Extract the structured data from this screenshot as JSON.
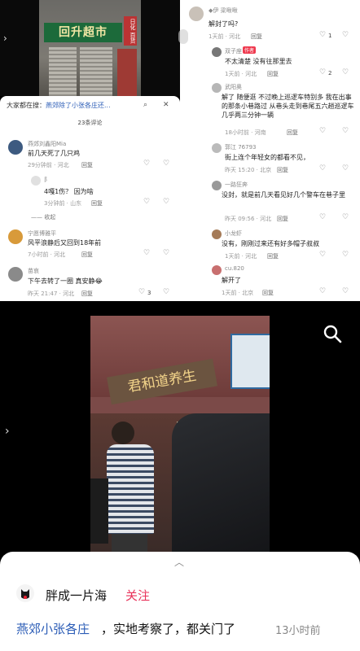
{
  "top_left_video": {
    "shop_sign": "回升超市",
    "sign_side": "日化 百货"
  },
  "left_panel": {
    "search_prefix": "大家都在搜：",
    "search_term": "燕郊除了小张各庄还...",
    "comment_count": "23条评论",
    "comments": [
      {
        "name": "燕郊刘鑫阳Mia",
        "text": "前几天死了几只鸡",
        "meta": "29分钟前 · 河北",
        "reply": "回复",
        "likes": ""
      },
      {
        "name": "阝",
        "text": "4嘎1伤？ 因为啥",
        "meta": "3分钟前 · 山东",
        "reply": "回复",
        "likes": ""
      },
      {
        "name": "",
        "text": "",
        "meta": "—— 收起",
        "reply": "",
        "likes": ""
      },
      {
        "name": "宁愿博雅平",
        "text": "风平浪静后又回到18年前",
        "meta": "7小时前 · 河北",
        "reply": "回复",
        "likes": ""
      },
      {
        "name": "苗哀",
        "text": "下午去转了一圈  真安静😂",
        "meta": "昨天 21:47 · 河北",
        "reply": "回复",
        "likes": "3"
      }
    ]
  },
  "right_panel": {
    "comments": [
      {
        "name": "◆伊 梁啾啾",
        "text": "解封了吗?",
        "meta": "1天前 · 河北",
        "reply": "回复",
        "likes": "1"
      },
      {
        "name": "双子座",
        "text": "不太清楚 没有往那里去",
        "meta": "1天前 · 河北",
        "reply": "回复",
        "likes": "2",
        "badge": "作者"
      },
      {
        "name": "武阳奥",
        "text": "解了  随便逛  不过晚上巡逻车特别多  我在出事的那条小巷路过  从巷头走到巷尾五六趟巡逻车  几乎两三分钟一辆",
        "meta": "18小时前 · 河南",
        "reply": "回复",
        "likes": ""
      },
      {
        "name": "郭江 76793",
        "text": "街上连个年轻女的都看不见，",
        "meta": "昨天 15:20 · 北京",
        "reply": "回复",
        "likes": ""
      },
      {
        "name": "一路狂奔",
        "text": "没封，就是前几天看见好几个警车在巷子里",
        "meta": "昨天 09:56 · 河北",
        "reply": "回复",
        "likes": ""
      },
      {
        "name": "小龙虾",
        "text": "没有，刚刚过来还有好多帽子叔叔",
        "meta": "1天前 · 河北",
        "reply": "回复",
        "likes": ""
      },
      {
        "name": "cu.820",
        "text": "解开了",
        "meta": "1天前 · 北京",
        "reply": "回复",
        "likes": ""
      }
    ]
  },
  "bottom_video": {
    "store_sign": "君和道养生",
    "search_icon": "search-icon"
  },
  "bottom_card": {
    "username": "胖成一片海",
    "follow": "关注",
    "hashtag": "燕郊小张各庄",
    "caption": "，实地考察了，都关门了",
    "time": "13小时前"
  },
  "colors": {
    "accent_red": "#e8325a",
    "link_blue": "#2b5cb6",
    "badge_red": "#ef3a4f"
  }
}
